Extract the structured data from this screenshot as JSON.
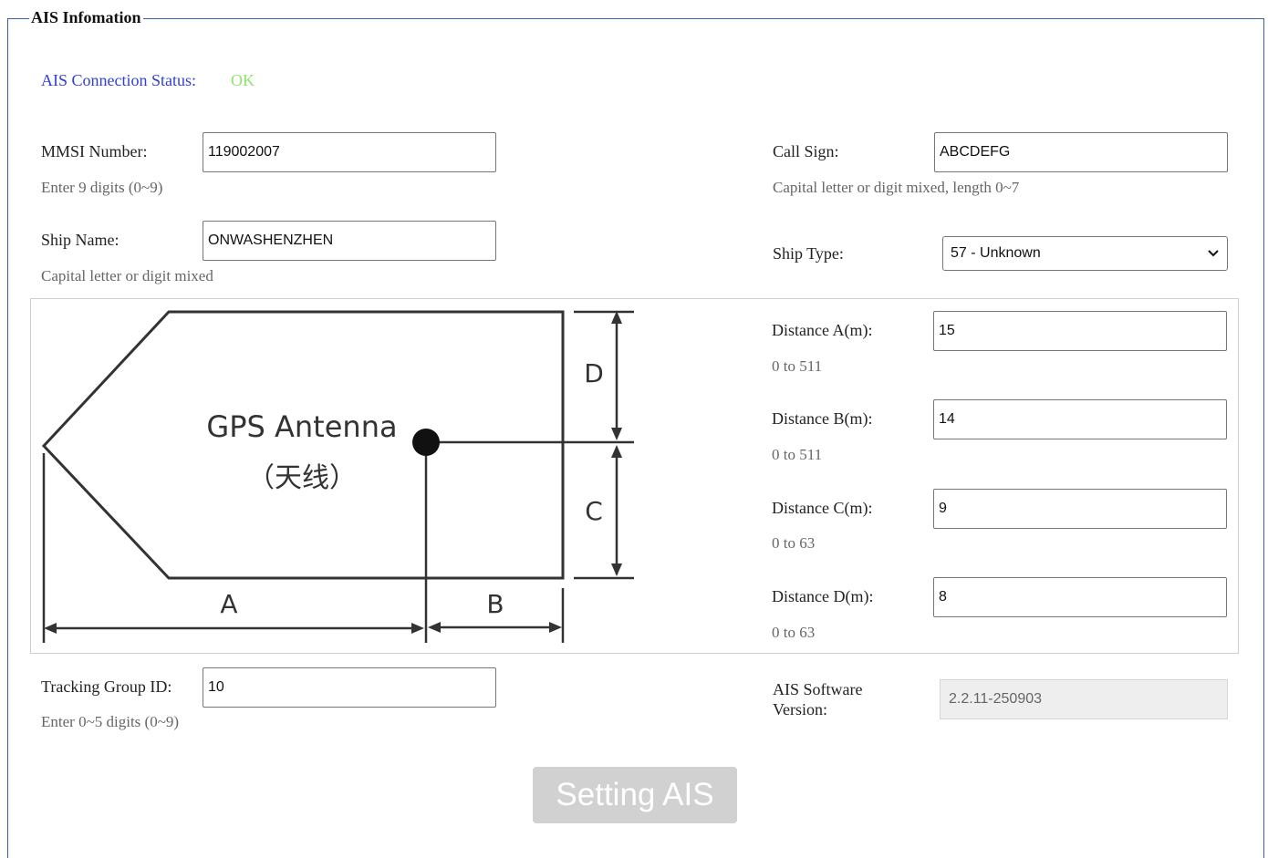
{
  "section": {
    "title": "AIS Infomation"
  },
  "status": {
    "label": "AIS Connection Status:",
    "value": "OK",
    "value_color": "#8fe36f"
  },
  "mmsi": {
    "label": "MMSI Number:",
    "value": "119002007",
    "hint": "Enter 9 digits (0~9)"
  },
  "call_sign": {
    "label": "Call Sign:",
    "value": "ABCDEFG",
    "hint": "Capital letter or digit mixed, length 0~7"
  },
  "ship_name": {
    "label": "Ship Name:",
    "value": "ONWASHENZHEN",
    "hint": "Capital letter or digit mixed"
  },
  "ship_type": {
    "label": "Ship Type:",
    "selected": "57 - Unknown"
  },
  "diagram": {
    "antenna_label": "GPS Antenna",
    "antenna_cn": "（天线）",
    "a": "A",
    "b": "B",
    "c": "C",
    "d": "D"
  },
  "distances": [
    {
      "label": "Distance A(m):",
      "value": "15",
      "hint": "0 to 511"
    },
    {
      "label": "Distance B(m):",
      "value": "14",
      "hint": "0 to 511"
    },
    {
      "label": "Distance C(m):",
      "value": "9",
      "hint": "0 to 63"
    },
    {
      "label": "Distance D(m):",
      "value": "8",
      "hint": "0 to 63"
    }
  ],
  "tracking": {
    "label": "Tracking Group ID:",
    "value": "10",
    "hint": "Enter 0~5 digits (0~9)"
  },
  "software": {
    "label_line1": "AIS Software",
    "label_line2": "Version:",
    "value": "2.2.11-250903"
  },
  "submit": {
    "label": "Setting AIS"
  }
}
